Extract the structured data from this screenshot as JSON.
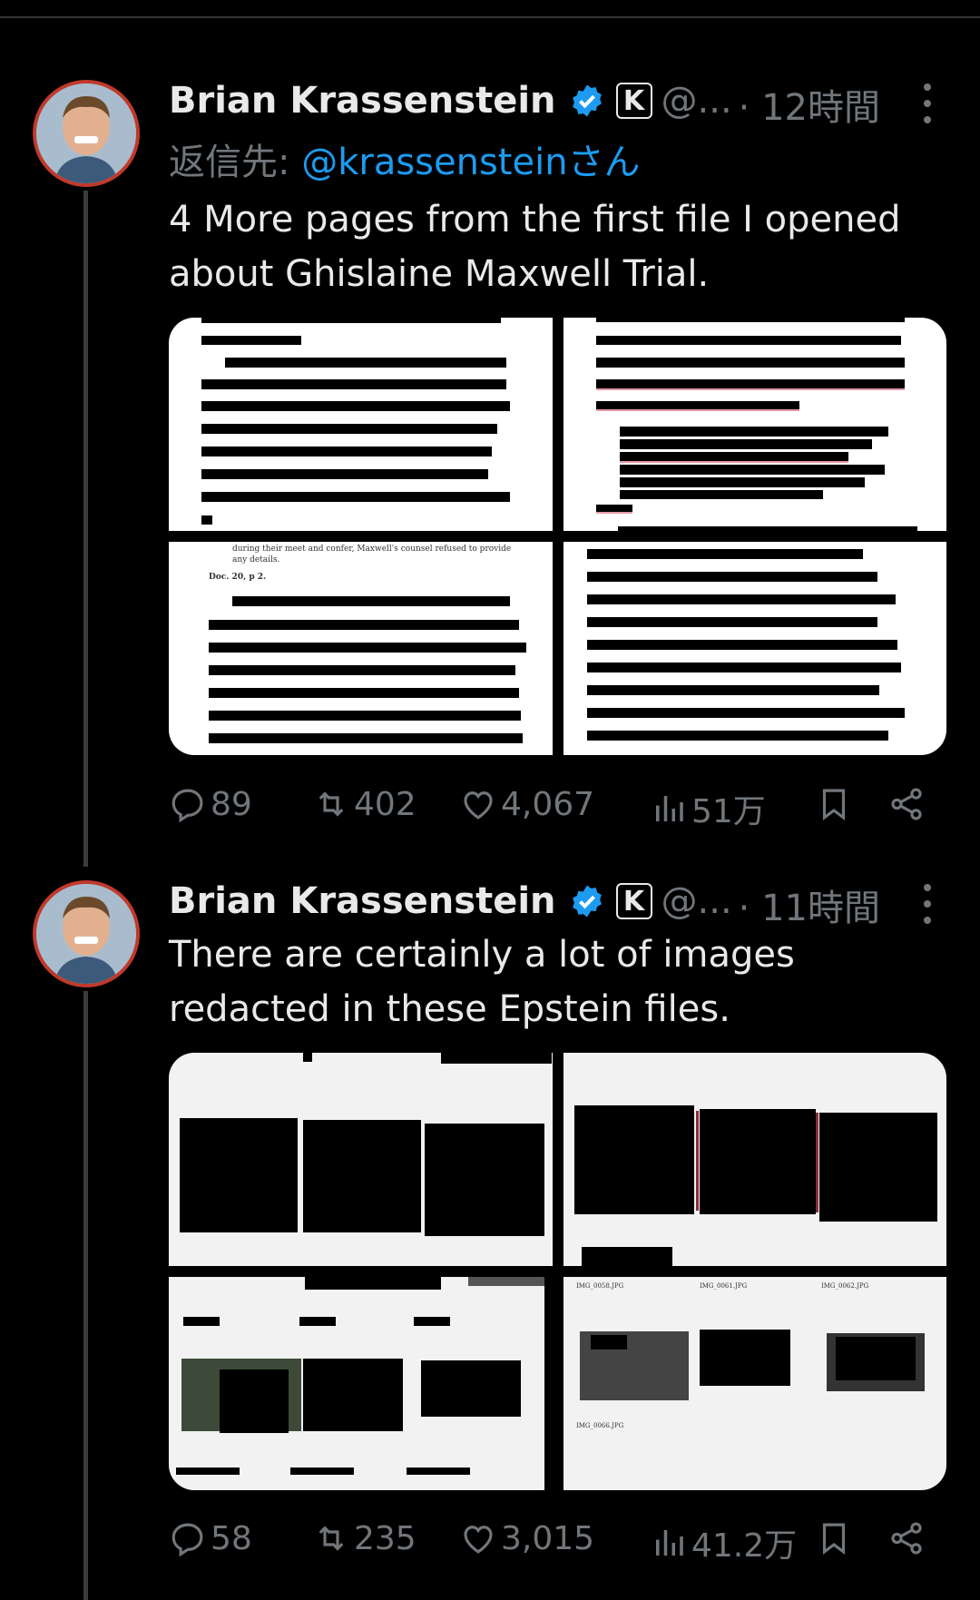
{
  "tweets": [
    {
      "name": "Brian Krassenstein",
      "k_badge": "K",
      "handle": "@...",
      "time": "· 12時間",
      "reply_prefix": "返信先: ",
      "reply_mention": "@krassensteinさん",
      "text": "4 More pages from the first file I opened about Ghislaine Maxwell Trial.",
      "media_caption_lines": [
        "during their meet and confer, Maxwell's counsel refused to provide",
        "any details.",
        "Doc. 20, p 2."
      ],
      "stats": {
        "replies": "89",
        "retweets": "402",
        "likes": "4,067",
        "views": "51万"
      }
    },
    {
      "name": "Brian Krassenstein",
      "k_badge": "K",
      "handle": "@...",
      "time": "· 11時間",
      "text": "There are certainly a lot of images redacted in these Epstein files.",
      "file_labels": [
        "IMG_0058.JPG",
        "IMG_0061.JPG",
        "IMG_0062.JPG",
        "IMG_0066.JPG"
      ],
      "stats": {
        "replies": "58",
        "retweets": "235",
        "likes": "3,015",
        "views": "41.2万"
      }
    }
  ],
  "colors": {
    "background": "#000000",
    "text": "#e7e9ea",
    "muted": "#71767b",
    "accent": "#1d9bf0",
    "avatar_ring": "#c0392b"
  },
  "icons": [
    "reply-icon",
    "retweet-icon",
    "like-icon",
    "views-icon",
    "bookmark-icon",
    "share-icon",
    "verified-icon",
    "more-icon"
  ]
}
